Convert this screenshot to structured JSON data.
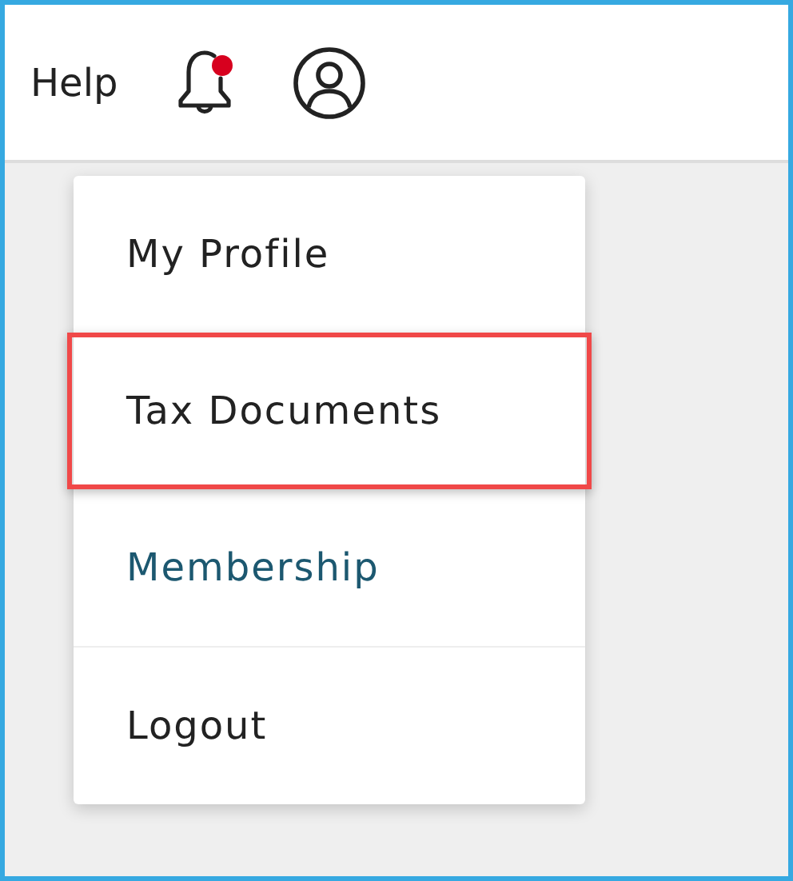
{
  "header": {
    "help": "Help",
    "notifications": {
      "unread": true
    }
  },
  "menu": {
    "items": [
      {
        "label": "My Profile",
        "kind": "plain",
        "selected": false,
        "divider_above": false
      },
      {
        "label": "Tax Documents",
        "kind": "plain",
        "selected": true,
        "divider_above": false
      },
      {
        "label": "Membership",
        "kind": "link",
        "selected": false,
        "divider_above": false
      },
      {
        "label": "Logout",
        "kind": "plain",
        "selected": false,
        "divider_above": true
      }
    ]
  }
}
